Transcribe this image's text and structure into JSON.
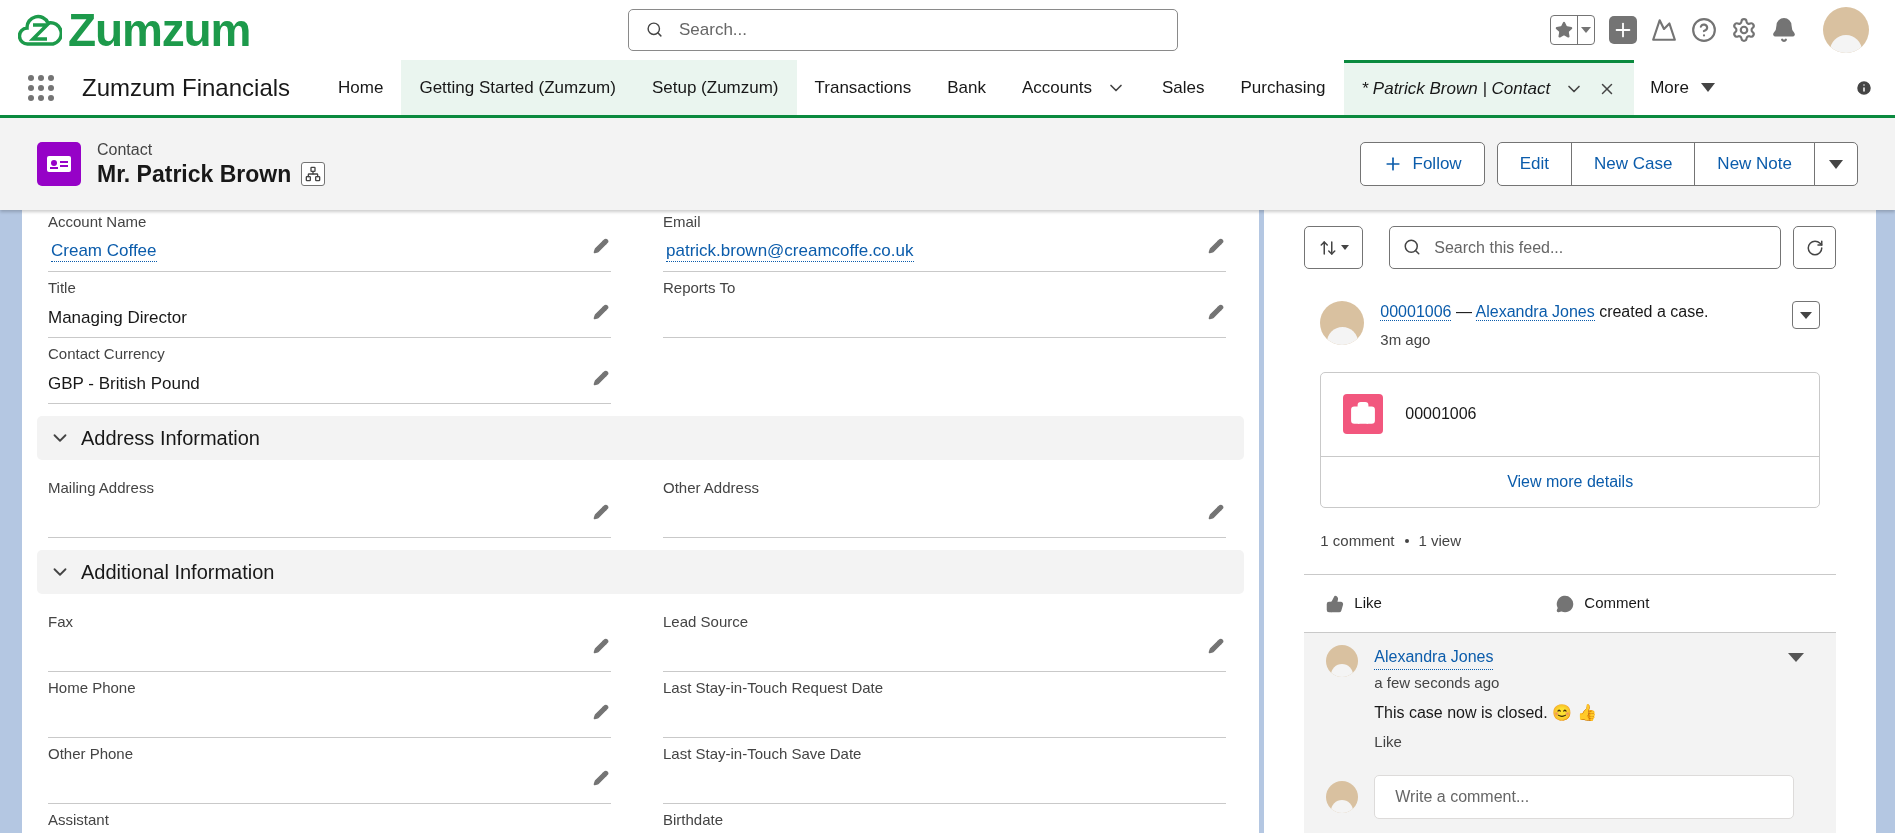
{
  "brand": {
    "name": "Zumzum"
  },
  "search": {
    "placeholder": "Search..."
  },
  "app_name": "Zumzum Financials",
  "nav_tabs": [
    {
      "label": "Home",
      "selected": false,
      "highlighted": false
    },
    {
      "label": "Getting Started (Zumzum)",
      "selected": false,
      "highlighted": true
    },
    {
      "label": "Setup (Zumzum)",
      "selected": false,
      "highlighted": true
    },
    {
      "label": "Transactions",
      "selected": false,
      "highlighted": false
    },
    {
      "label": "Bank",
      "selected": false,
      "highlighted": false
    },
    {
      "label": "Accounts",
      "selected": false,
      "highlighted": false,
      "menu": true
    },
    {
      "label": "Sales",
      "selected": false,
      "highlighted": false
    },
    {
      "label": "Purchasing",
      "selected": false,
      "highlighted": false
    },
    {
      "label": "* Patrick Brown | Contact",
      "selected": true,
      "highlighted": true,
      "menu": true,
      "closable": true
    }
  ],
  "more_tab": "More",
  "record": {
    "object": "Contact",
    "name": "Mr. Patrick Brown",
    "actions": [
      "Edit",
      "New Case",
      "New Note"
    ],
    "follow": "Follow"
  },
  "sections": [
    {
      "rows": [
        {
          "left": {
            "label": "Account Name",
            "value": "Cream Coffee",
            "kind": "link",
            "editable": true
          },
          "right": {
            "label": "Email",
            "value": "patrick.brown@creamcoffe.co.uk",
            "kind": "link",
            "editable": true
          }
        },
        {
          "left": {
            "label": "Title",
            "value": "Managing Director",
            "kind": "text",
            "editable": true
          },
          "right": {
            "label": "Reports To",
            "editable": true
          }
        },
        {
          "left": {
            "label": "Contact Currency",
            "value": "GBP - British Pound",
            "kind": "text",
            "editable": true
          }
        }
      ]
    },
    {
      "title": "Address Information",
      "expanded": true,
      "rows": [
        {
          "left": {
            "label": "Mailing Address",
            "editable": true
          },
          "right": {
            "label": "Other Address",
            "editable": true
          }
        }
      ]
    },
    {
      "title": "Additional Information",
      "expanded": true,
      "rows": [
        {
          "left": {
            "label": "Fax",
            "editable": true
          },
          "right": {
            "label": "Lead Source",
            "editable": true
          }
        },
        {
          "left": {
            "label": "Home Phone",
            "editable": true
          },
          "right": {
            "label": "Last Stay-in-Touch Request Date",
            "editable": false
          }
        },
        {
          "left": {
            "label": "Other Phone",
            "editable": true
          },
          "right": {
            "label": "Last Stay-in-Touch Save Date",
            "editable": false
          }
        },
        {
          "left": {
            "label": "Assistant",
            "editable": false
          },
          "right": {
            "label": "Birthdate",
            "editable": false
          }
        }
      ]
    }
  ],
  "feed": {
    "search_placeholder": "Search this feed...",
    "post": {
      "case_link": "00001006",
      "dash": "—",
      "author": "Alexandra Jones",
      "action": "created a case.",
      "time": "3m ago",
      "card": {
        "number": "00001006",
        "link": "View more details"
      },
      "stats": [
        "1 comment",
        "1 view"
      ],
      "actions": [
        {
          "kind": "like",
          "label": "Like"
        },
        {
          "kind": "comment",
          "label": "Comment"
        }
      ],
      "comment": {
        "author": "Alexandra Jones",
        "time": "a few seconds ago",
        "text": "This case now is closed. 😊 👍",
        "like": "Like"
      },
      "reply_placeholder": "Write a comment..."
    }
  }
}
